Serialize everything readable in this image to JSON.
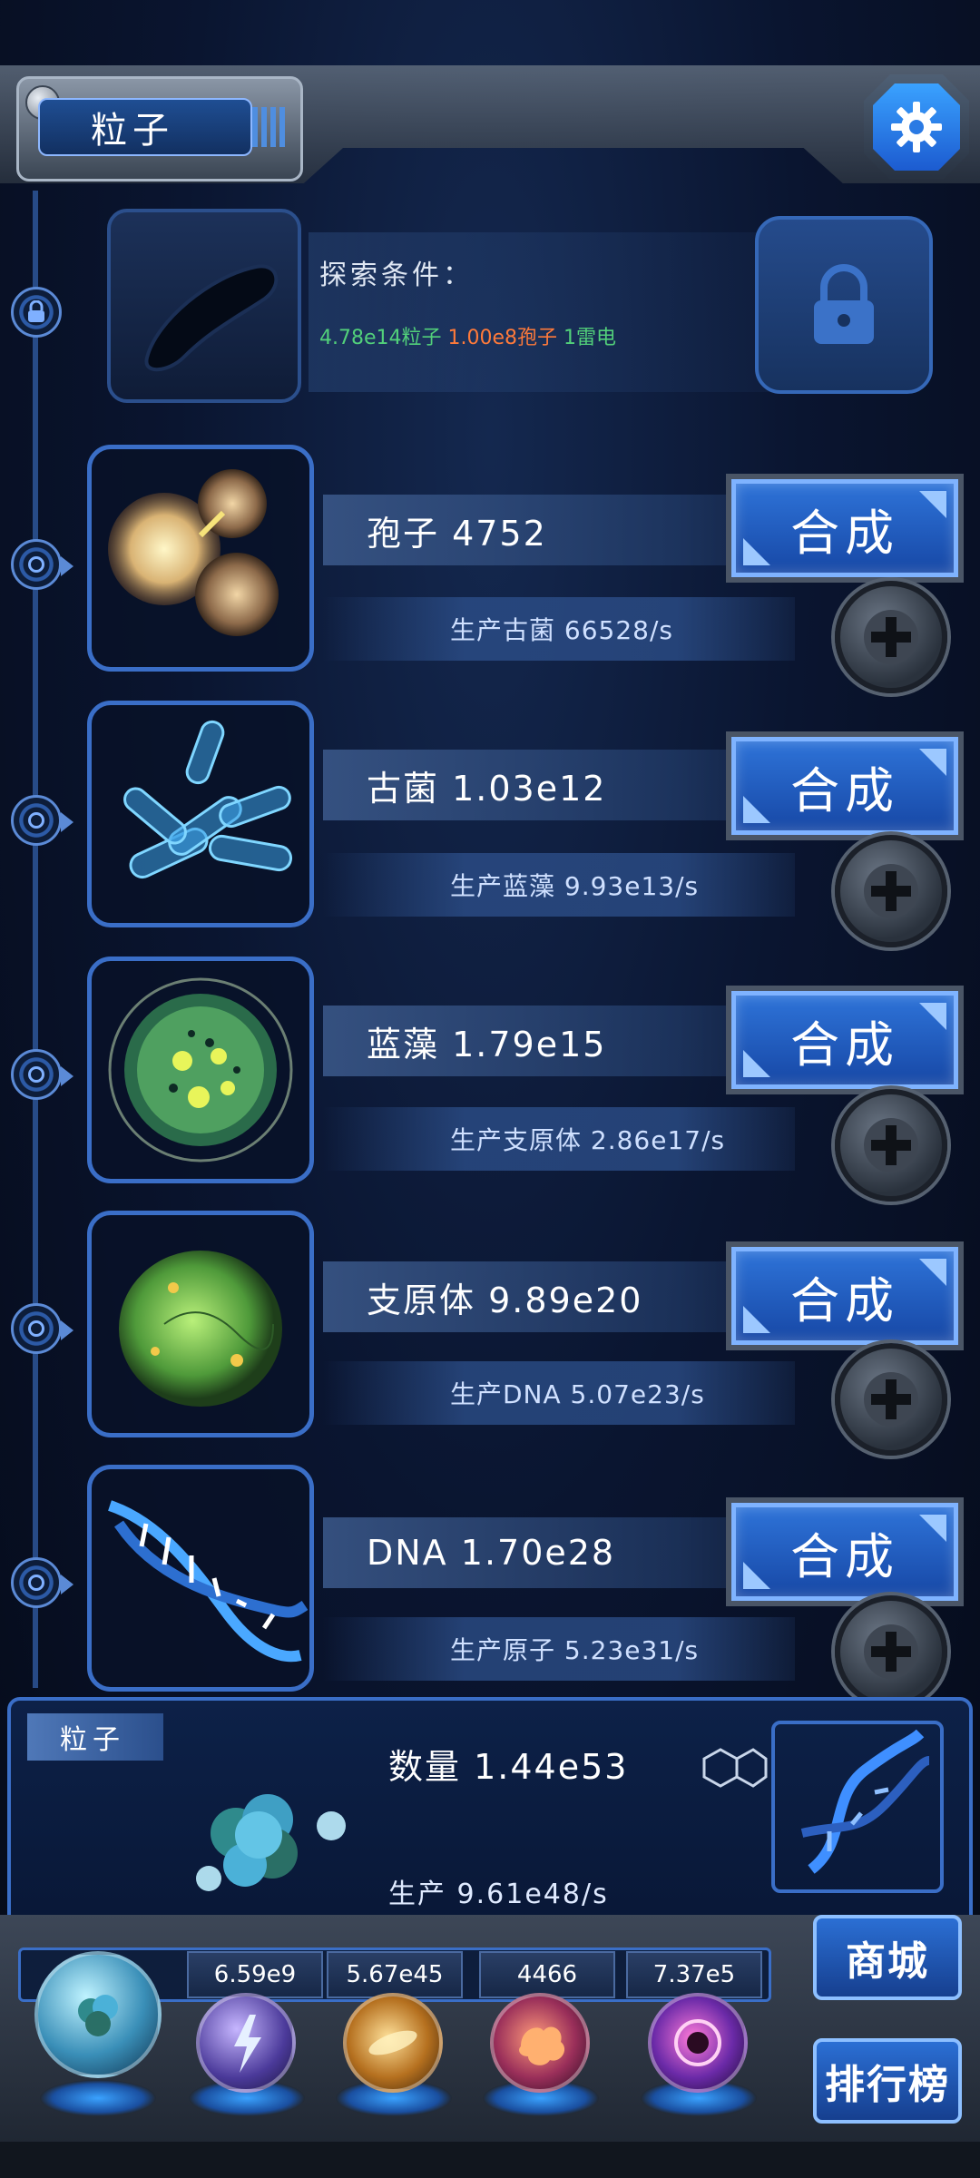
{
  "header": {
    "title": "粒子",
    "settings_icon": "gear-icon"
  },
  "locked_item": {
    "condition_label": "探索条件：",
    "conditions": [
      {
        "text": "4.78e14粒子",
        "color": "#52d07a"
      },
      {
        "text": "1.00e8孢子",
        "color": "#ff7a3a"
      },
      {
        "text": "1雷电",
        "color": "#52d07a"
      }
    ]
  },
  "items": [
    {
      "name": "孢子 4752",
      "production": "生产古菌 66528/s",
      "action": "合成"
    },
    {
      "name": "古菌 1.03e12",
      "production": "生产蓝藻 9.93e13/s",
      "action": "合成"
    },
    {
      "name": "蓝藻 1.79e15",
      "production": "生产支原体 2.86e17/s",
      "action": "合成"
    },
    {
      "name": "支原体 9.89e20",
      "production": "生产DNA 5.07e23/s",
      "action": "合成"
    },
    {
      "name": "DNA 1.70e28",
      "production": "生产原子 5.23e31/s",
      "action": "合成"
    }
  ],
  "particle_panel": {
    "tag": "粒子",
    "quantity": "数量 1.44e53",
    "production": "生产 9.61e48/s"
  },
  "dock": {
    "counts": [
      "6.59e9",
      "5.67e45",
      "4466",
      "7.37e5"
    ],
    "shop_label": "商城",
    "rank_label": "排行榜"
  },
  "colors": {
    "accent": "#3a6ec7",
    "button": "#2e73d8",
    "cond_green": "#52d07a",
    "cond_orange": "#ff7a3a"
  }
}
